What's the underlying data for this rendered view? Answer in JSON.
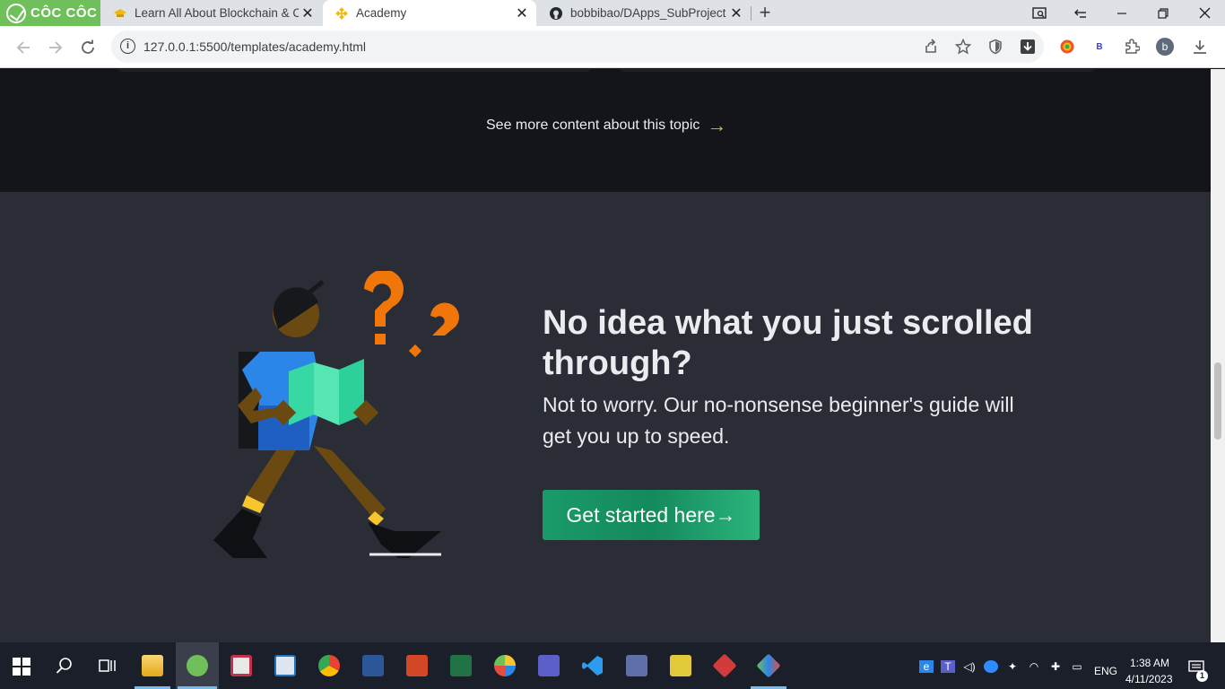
{
  "browser": {
    "brand": "CÔC CÔC",
    "tabs": [
      {
        "title": "Learn All About Blockchain & C",
        "close": "✕"
      },
      {
        "title": "Academy",
        "close": "✕"
      },
      {
        "title": "bobbibao/DApps_SubProject",
        "close": "✕"
      }
    ],
    "new_tab": "+",
    "url": "127.0.0.1:5500/templates/academy.html",
    "profile_initial": "b",
    "ext_label": "B"
  },
  "page": {
    "see_more": "See more content about this topic",
    "arrow": "→",
    "headline": "No idea what you just scrolled through?",
    "subtext": "Not to worry. Our no-nonsense beginner's guide will get you up to speed.",
    "cta": "Get started here→"
  },
  "taskbar": {
    "lang": "ENG",
    "time": "1:38 AM",
    "date": "4/11/2023",
    "notification_count": "1"
  },
  "colors": {
    "accent": "#f0b90b",
    "cta_green": "#1a9a6a",
    "dark_bg": "#14151a",
    "section_bg": "#2a2d35"
  }
}
